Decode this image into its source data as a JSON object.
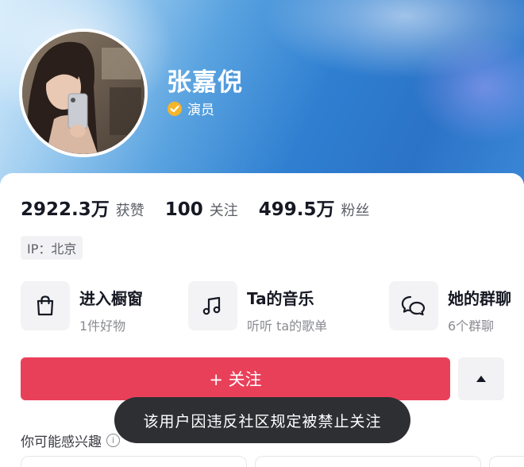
{
  "profile": {
    "name": "张嘉倪",
    "verified_label": "演员"
  },
  "stats": [
    {
      "value": "2922.3万",
      "label": "获赞"
    },
    {
      "value": "100",
      "label": "关注"
    },
    {
      "value": "499.5万",
      "label": "粉丝"
    }
  ],
  "ip_tag": "IP：北京",
  "features": [
    {
      "title": "进入橱窗",
      "subtitle": "1件好物",
      "icon": "shopping-bag-icon"
    },
    {
      "title": "Ta的音乐",
      "subtitle": "听听 ta的歌单",
      "icon": "music-note-icon"
    },
    {
      "title": "她的群聊",
      "subtitle": "6个群聊",
      "icon": "chat-bubble-icon"
    }
  ],
  "actions": {
    "follow_label": "+ 关注",
    "more_icon": "caret-up-icon"
  },
  "suggest": {
    "label": "你可能感兴趣",
    "info_glyph": "i"
  },
  "toast": "该用户因违反社区规定被禁止关注",
  "colors": {
    "follow_button": "#e9405a",
    "verified_badge": "#f5b52b",
    "toast_bg": "#2e2f33"
  }
}
